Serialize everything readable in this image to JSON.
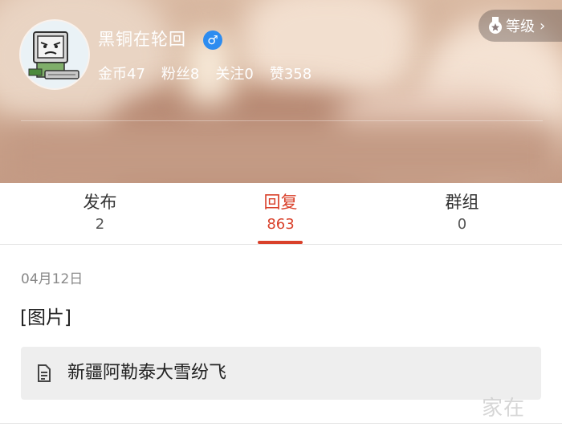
{
  "profile": {
    "username": "黑铜在轮回",
    "gender_icon": "♂",
    "stats": [
      {
        "label": "金币",
        "value": "47"
      },
      {
        "label": "粉丝",
        "value": "8"
      },
      {
        "label": "关注",
        "value": "0"
      },
      {
        "label": "赞",
        "value": "358"
      }
    ],
    "level_button": {
      "label": "等级",
      "chevron": "›"
    }
  },
  "tabs": [
    {
      "label": "发布",
      "count": "2",
      "active": false
    },
    {
      "label": "回复",
      "count": "863",
      "active": true
    },
    {
      "label": "群组",
      "count": "0",
      "active": false
    }
  ],
  "post": {
    "date": "04月12日",
    "text": "[图片]",
    "link_title": "新疆阿勒泰大雪纷飞",
    "link_icon": "document-icon"
  },
  "watermark": "家在",
  "colors": {
    "accent": "#d9412b",
    "gender_badge": "#2d8cf0",
    "card_bg": "#eeeeee"
  }
}
